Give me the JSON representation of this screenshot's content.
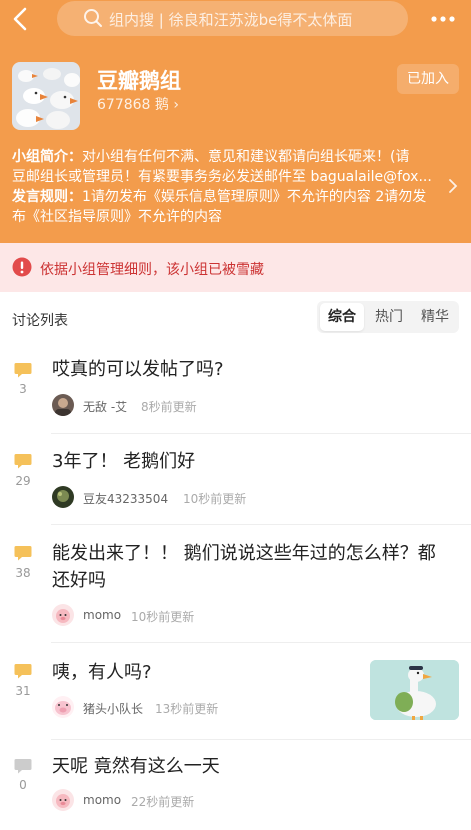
{
  "topbar": {
    "search_placeholder": "组内搜 | 徐良和汪苏泷be得不太体面",
    "icons": [
      "back-icon",
      "search-icon",
      "more-icon"
    ]
  },
  "group": {
    "name": "豆瓣鹅组",
    "members": "677868 鹅 ›",
    "join_label": "已加入",
    "intro_label": "小组简介：",
    "intro_line1": "对小组有任何不满、意见和建议都请向组长砸来！(请",
    "intro_line2": "豆邮组长或管理员！有紧要事务务必发送邮件至 bagualaile@fox...",
    "rules_label": "发言规则：",
    "rules_line1": "1请勿发布《娱乐信息管理原则》不允许的内容 2请勿发",
    "rules_line2": "布《社区指导原则》不允许的内容"
  },
  "alert": {
    "text": "依据小组管理细则，该小组已被雪藏",
    "color": "#cc3333"
  },
  "list": {
    "title": "讨论列表",
    "tabs": [
      "综合",
      "热门",
      "精华"
    ],
    "active_tab": "综合"
  },
  "posts": [
    {
      "comments": "3",
      "title": "哎真的可以发帖了吗?",
      "author": "无敌 -艾",
      "time": "8秒前更新"
    },
    {
      "comments": "29",
      "title": "3年了！ 老鹅们好",
      "author": "豆友43233504",
      "time": "10秒前更新"
    },
    {
      "comments": "38",
      "title_line1": "能发出来了！！ 鹅们说说这些年过的怎么样？都",
      "title_line2": "还好吗",
      "author": "momo",
      "time": "10秒前更新"
    },
    {
      "comments": "31",
      "title": "咦，有人吗?",
      "author": "猪头小队长",
      "time": "13秒前更新"
    },
    {
      "comments": "0",
      "title": "天呢 竟然有这么一天",
      "author": "momo",
      "time": "22秒前更新"
    }
  ],
  "colors": {
    "header_bg": "#f39c4c",
    "comment_icon": "#f5c15a",
    "comment_icon_empty": "#cccccc"
  }
}
